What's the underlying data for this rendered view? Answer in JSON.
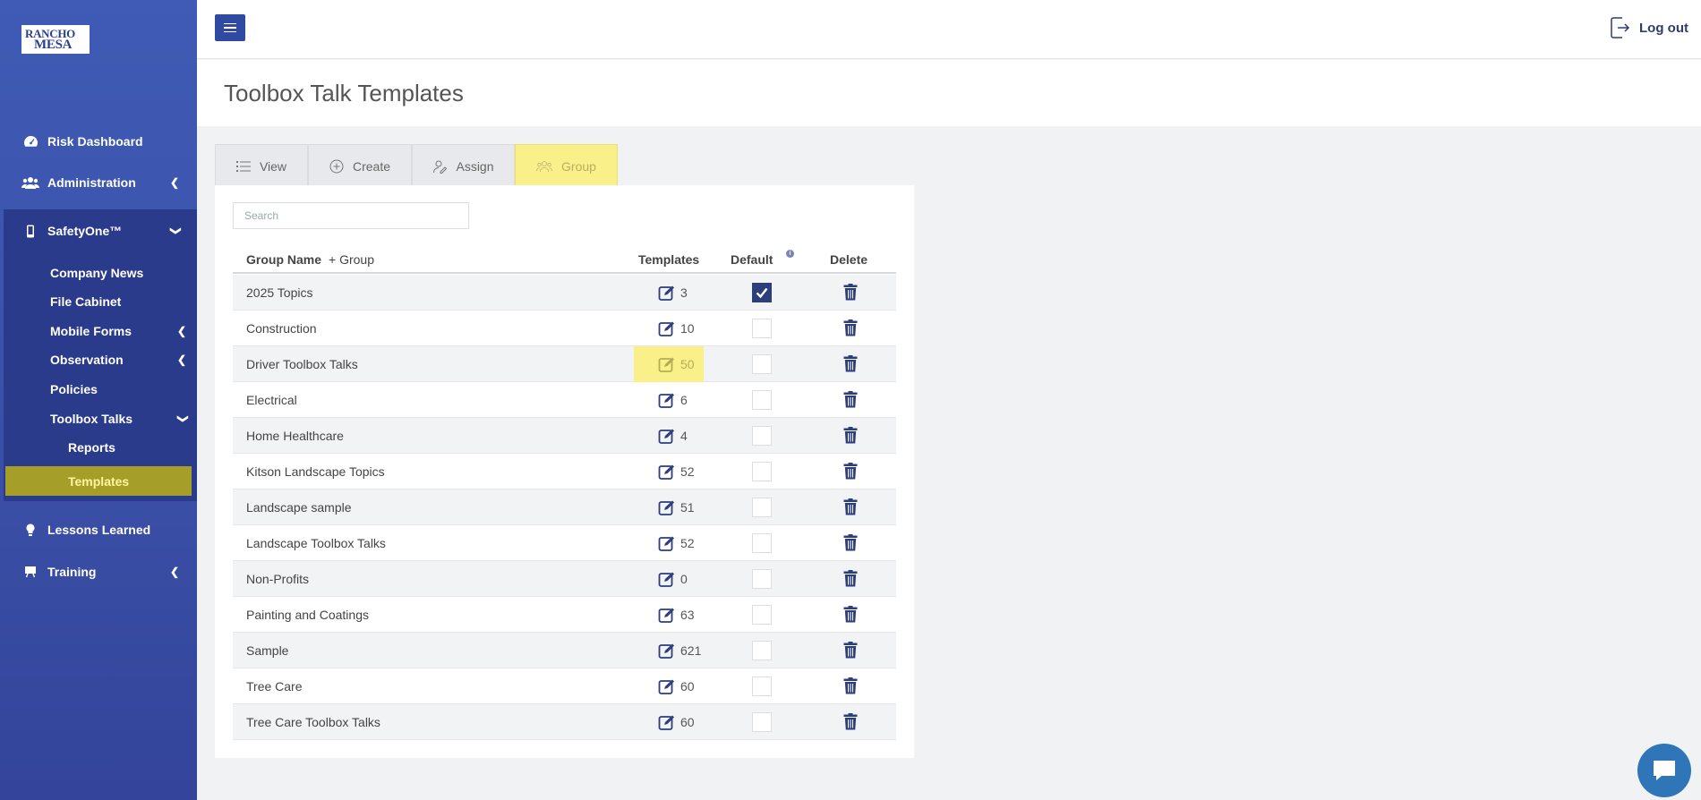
{
  "logo": {
    "line1": "RANCHO",
    "line2": "MESA"
  },
  "sidebar": {
    "items": [
      {
        "label": "Risk Dashboard",
        "icon": "gauge-icon"
      },
      {
        "label": "Administration",
        "icon": "users-icon"
      },
      {
        "label": "SafetyOne™",
        "icon": "mobile-icon"
      },
      {
        "label": "Lessons Learned",
        "icon": "lightbulb-icon"
      },
      {
        "label": "Training",
        "icon": "easel-icon"
      }
    ],
    "safety_sub": [
      {
        "label": "Company News"
      },
      {
        "label": "File Cabinet"
      },
      {
        "label": "Mobile Forms"
      },
      {
        "label": "Observation"
      },
      {
        "label": "Policies"
      },
      {
        "label": "Toolbox Talks"
      }
    ],
    "toolbox_sub": [
      {
        "label": "Reports"
      },
      {
        "label": "Templates"
      }
    ]
  },
  "topbar": {
    "logout_label": "Log out"
  },
  "page": {
    "title": "Toolbox Talk Templates"
  },
  "tabs": [
    {
      "label": "View",
      "icon": "list-icon"
    },
    {
      "label": "Create",
      "icon": "plus-circle-icon"
    },
    {
      "label": "Assign",
      "icon": "assign-user-icon"
    },
    {
      "label": "Group",
      "icon": "group-icon",
      "active": true
    }
  ],
  "search": {
    "placeholder": "Search"
  },
  "table": {
    "headers": {
      "name": "Group Name",
      "add_group": "+ Group",
      "templates": "Templates",
      "default": "Default",
      "delete": "Delete"
    },
    "rows": [
      {
        "name": "2025 Topics",
        "templates": "3",
        "default": true
      },
      {
        "name": "Construction",
        "templates": "10",
        "default": false
      },
      {
        "name": "Driver Toolbox Talks",
        "templates": "50",
        "default": false,
        "highlight": true
      },
      {
        "name": "Electrical",
        "templates": "6",
        "default": false
      },
      {
        "name": "Home Healthcare",
        "templates": "4",
        "default": false
      },
      {
        "name": "Kitson Landscape Topics",
        "templates": "52",
        "default": false
      },
      {
        "name": "Landscape sample",
        "templates": "51",
        "default": false
      },
      {
        "name": "Landscape Toolbox Talks",
        "templates": "52",
        "default": false
      },
      {
        "name": "Non-Profits",
        "templates": "0",
        "default": false
      },
      {
        "name": "Painting and Coatings",
        "templates": "63",
        "default": false
      },
      {
        "name": "Sample",
        "templates": "621",
        "default": false
      },
      {
        "name": "Tree Care",
        "templates": "60",
        "default": false
      },
      {
        "name": "Tree Care Toolbox Talks",
        "templates": "60",
        "default": false
      }
    ]
  },
  "colors": {
    "sidebar": "#3a4fa6",
    "accent_yellow": "#faf08a",
    "navy": "#2d3e7a"
  }
}
